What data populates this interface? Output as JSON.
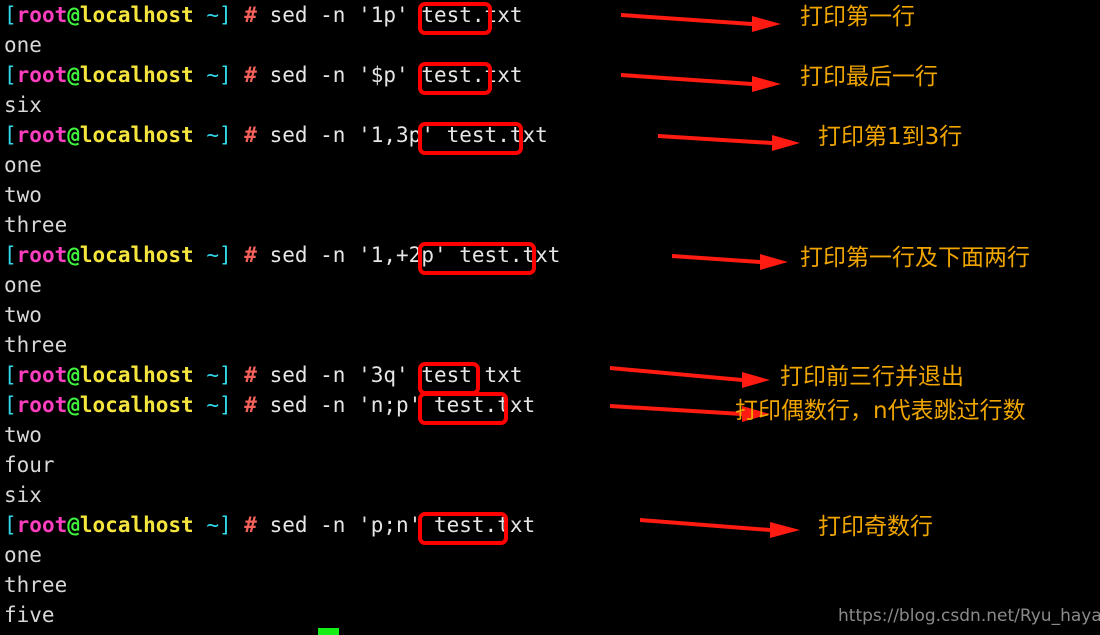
{
  "terminal": {
    "background_color": "#000000",
    "prompt": {
      "bracket_open": "[",
      "user": "root",
      "at": "@",
      "host": "localhost",
      "tilde": " ~",
      "bracket_close": "]",
      "hash": "#",
      "colors": {
        "bracket": "#2fd7e8",
        "user": "#ff3ebf",
        "at": "#3ef23e",
        "host": "#f5e53d",
        "hash": "#f4605a",
        "text": "#d8d8d8"
      }
    },
    "lines": [
      {
        "type": "prompt",
        "pre": " sed -n ",
        "highlight": "'1p'",
        "post": "test.txt"
      },
      {
        "type": "output",
        "text": "one"
      },
      {
        "type": "prompt",
        "pre": " sed -n ",
        "highlight": "'$p'",
        "post": "test.txt"
      },
      {
        "type": "output",
        "text": "six"
      },
      {
        "type": "prompt",
        "pre": " sed -n ",
        "highlight": "'1,3p'",
        "post": "test.txt"
      },
      {
        "type": "output",
        "text": "one"
      },
      {
        "type": "output",
        "text": "two"
      },
      {
        "type": "output",
        "text": "three"
      },
      {
        "type": "prompt",
        "pre": " sed -n ",
        "highlight": "'1,+2p'",
        "post": " test.txt"
      },
      {
        "type": "output",
        "text": "one"
      },
      {
        "type": "output",
        "text": "two"
      },
      {
        "type": "output",
        "text": "three"
      },
      {
        "type": "prompt",
        "pre": " sed -n ",
        "highlight": "'3q'",
        "post": " test.txt"
      },
      {
        "type": "prompt",
        "pre": " sed -n ",
        "highlight": "'n;p'",
        "post": "test.txt"
      },
      {
        "type": "output",
        "text": "two"
      },
      {
        "type": "output",
        "text": "four"
      },
      {
        "type": "output",
        "text": "six"
      },
      {
        "type": "prompt",
        "pre": " sed -n ",
        "highlight": "'p;n'",
        "post": "test.txt"
      },
      {
        "type": "output",
        "text": "one"
      },
      {
        "type": "output",
        "text": "three"
      },
      {
        "type": "output",
        "text": "five"
      }
    ]
  },
  "annotations": {
    "color": "#f0a500",
    "arrow_color": "#ff0000",
    "items": [
      {
        "text": "打印第一行"
      },
      {
        "text": "打印最后一行"
      },
      {
        "text": "打印第1到3行"
      },
      {
        "text": "打印第一行及下面两行"
      },
      {
        "text": "打印前三行并退出"
      },
      {
        "text": "打印偶数行，n代表跳过行数"
      },
      {
        "text": "打印奇数行"
      }
    ]
  },
  "watermark": {
    "text": "https://blog.csdn.net/Ryu_hayabusa",
    "color": "#8a8a8a"
  },
  "cursor": {
    "color": "#16ef16"
  }
}
